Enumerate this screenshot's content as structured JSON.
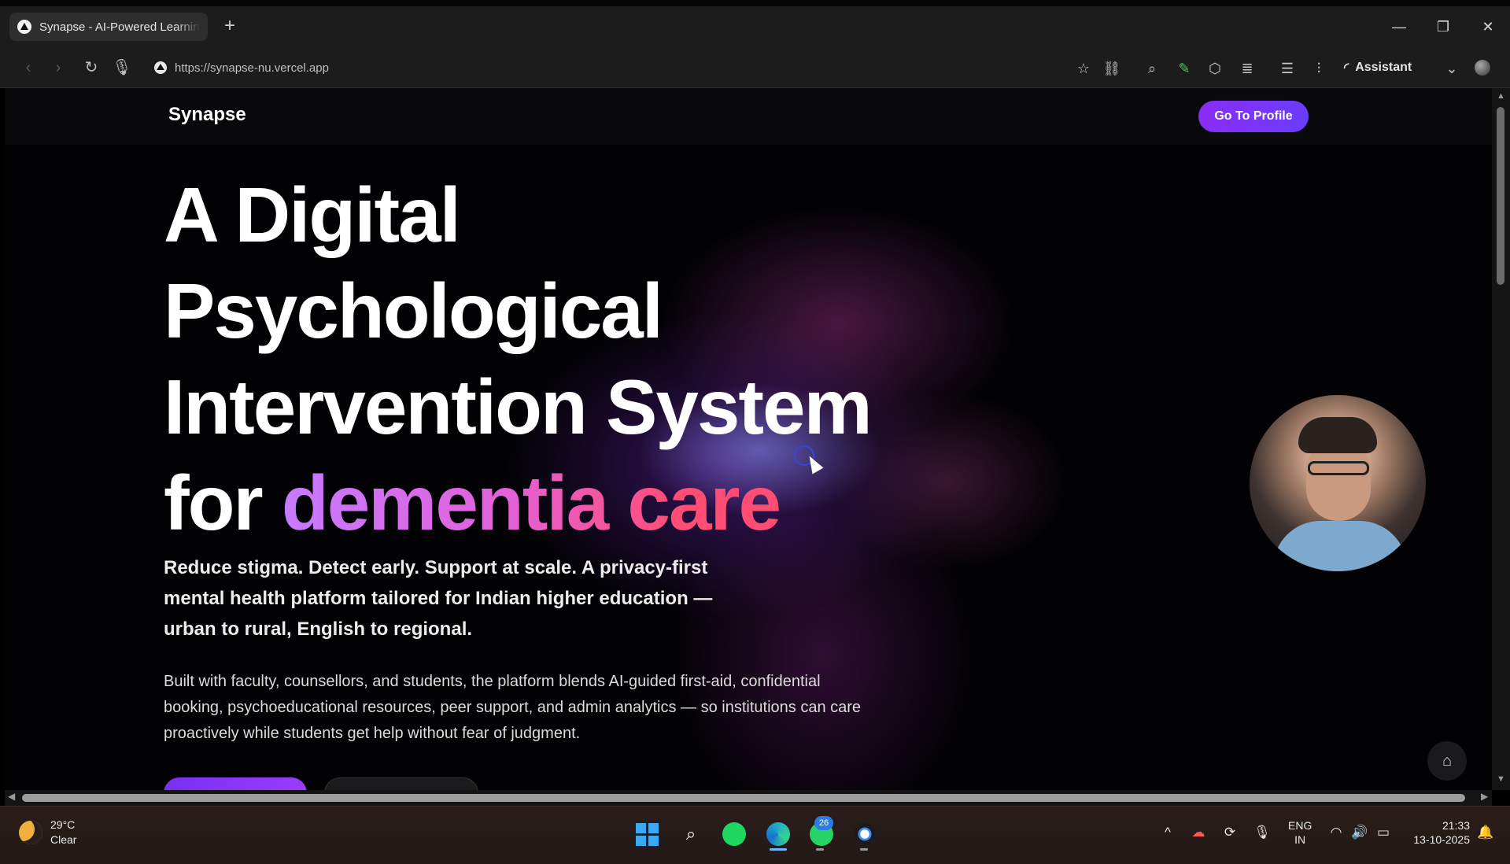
{
  "browser": {
    "tab_title": "Synapse - AI-Powered Learnin",
    "new_tab_label": "+",
    "url": "https://synapse-nu.vercel.app",
    "assistant_label": "Assistant",
    "window_controls": [
      "—",
      "❐",
      "✕"
    ]
  },
  "site": {
    "brand": "Synapse",
    "profile_button": "Go To Profile",
    "hero": {
      "line1": "A Digital",
      "line2": "Psychological",
      "line3": "Intervention System",
      "line4_prefix": "for",
      "line4_accent": "dementia care"
    },
    "lead": "Reduce stigma. Detect early. Support at scale. A privacy-first mental health platform tailored for Indian higher education — urban to rural, English to regional.",
    "body": "Built with faculty, counsellors, and students, the platform blends AI-guided first-aid, confidential booking, psychoeducational resources, peer support, and admin analytics — so institutions can care proactively while students get help without fear of judgment."
  },
  "taskbar": {
    "temperature": "29°C",
    "condition": "Clear",
    "whatsapp_badge": "26",
    "lang_line1": "ENG",
    "lang_line2": "IN",
    "time": "21:33",
    "date": "13-10-2025"
  },
  "colors": {
    "accent_purple": "#8b2cf5",
    "accent_pink": "#ff4d73",
    "background": "#020204"
  }
}
